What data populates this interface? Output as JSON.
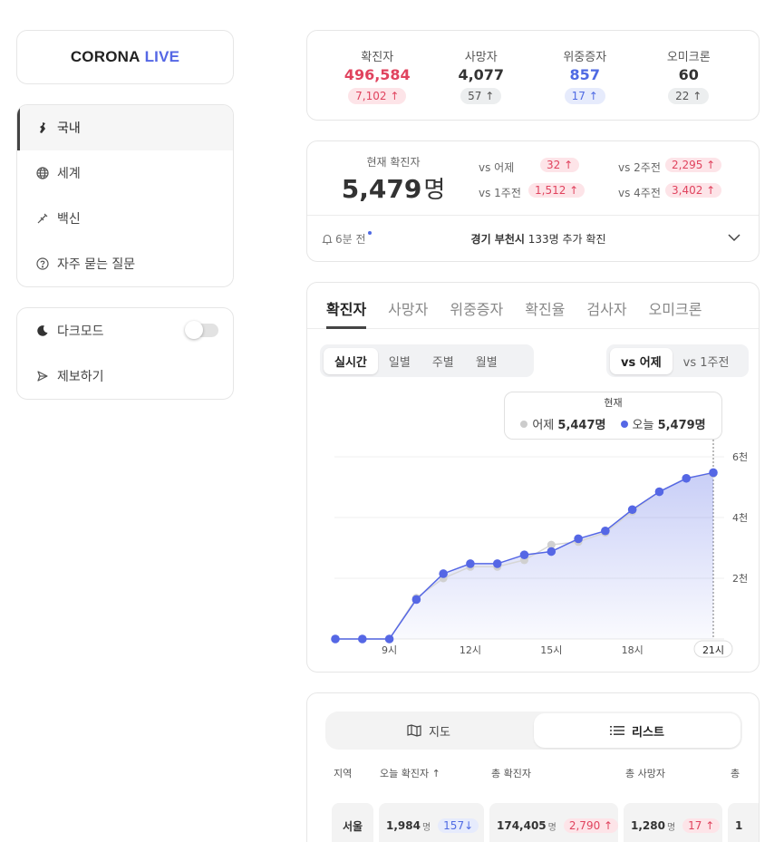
{
  "logo": {
    "part1": "CORONA",
    "part2": "LIVE"
  },
  "nav": {
    "items": [
      {
        "label": "국내",
        "icon": "korea-map-icon"
      },
      {
        "label": "세계",
        "icon": "globe-icon"
      },
      {
        "label": "백신",
        "icon": "syringe-icon"
      },
      {
        "label": "자주 묻는 질문",
        "icon": "question-circle-icon"
      }
    ]
  },
  "settings": {
    "dark_mode": "다크모드",
    "dark_mode_on": false,
    "report": "제보하기"
  },
  "stats": [
    {
      "label": "확진자",
      "value": "496,584",
      "delta": "7,102",
      "tone": "red"
    },
    {
      "label": "사망자",
      "value": "4,077",
      "delta": "57",
      "tone": "gray"
    },
    {
      "label": "위중증자",
      "value": "857",
      "delta": "17",
      "tone": "blue"
    },
    {
      "label": "오미크론",
      "value": "60",
      "delta": "22",
      "tone": "gray"
    }
  ],
  "current": {
    "title": "현재 확진자",
    "value": "5,479",
    "unit": "명",
    "vs": [
      {
        "label": "vs 어제",
        "value": "32"
      },
      {
        "label": "vs 2주전",
        "value": "2,295"
      },
      {
        "label": "vs 1주전",
        "value": "1,512"
      },
      {
        "label": "vs 4주전",
        "value": "3,402"
      }
    ],
    "update_time": "6분 전",
    "news_region": "경기 부천시",
    "news_text": "133명 추가 확진"
  },
  "chart_tabs": [
    "확진자",
    "사망자",
    "위중증자",
    "확진율",
    "검사자",
    "오미크론"
  ],
  "period_tabs": [
    "실시간",
    "일별",
    "주별",
    "월별"
  ],
  "compare_tabs": [
    "vs 어제",
    "vs 1주전"
  ],
  "tooltip": {
    "title": "현재",
    "yesterday_label": "어제",
    "yesterday_value": "5,447명",
    "today_label": "오늘",
    "today_value": "5,479명"
  },
  "chart_data": {
    "type": "line",
    "x": [
      7,
      8,
      9,
      10,
      11,
      12,
      13,
      14,
      15,
      16,
      17,
      18,
      19,
      20,
      21
    ],
    "x_ticks": [
      "9시",
      "12시",
      "15시",
      "18시",
      "21시"
    ],
    "y_ticks": [
      "2천",
      "4천",
      "6천"
    ],
    "ylim": [
      0,
      6000
    ],
    "series": [
      {
        "name": "어제",
        "color": "#cccccc",
        "values": [
          0,
          0,
          0,
          1350,
          2000,
          2380,
          2380,
          2600,
          3100,
          3200,
          3500,
          4200,
          4850,
          5300,
          5447
        ]
      },
      {
        "name": "오늘",
        "color": "#5567e5",
        "values": [
          0,
          0,
          0,
          1300,
          2150,
          2480,
          2480,
          2770,
          2880,
          3300,
          3560,
          4260,
          4850,
          5290,
          5479
        ]
      }
    ],
    "grid": true
  },
  "list": {
    "map_label": "지도",
    "list_label": "리스트",
    "headers": [
      "지역",
      "오늘 확진자",
      "총 확진자",
      "총 사망자",
      "총"
    ],
    "rows": [
      {
        "region": "서울",
        "today": "1,984",
        "today_delta": "157",
        "total": "174,405",
        "total_delta": "2,790",
        "deaths": "1,280",
        "deaths_delta": "17",
        "extra": "1"
      }
    ],
    "unit": "명"
  }
}
